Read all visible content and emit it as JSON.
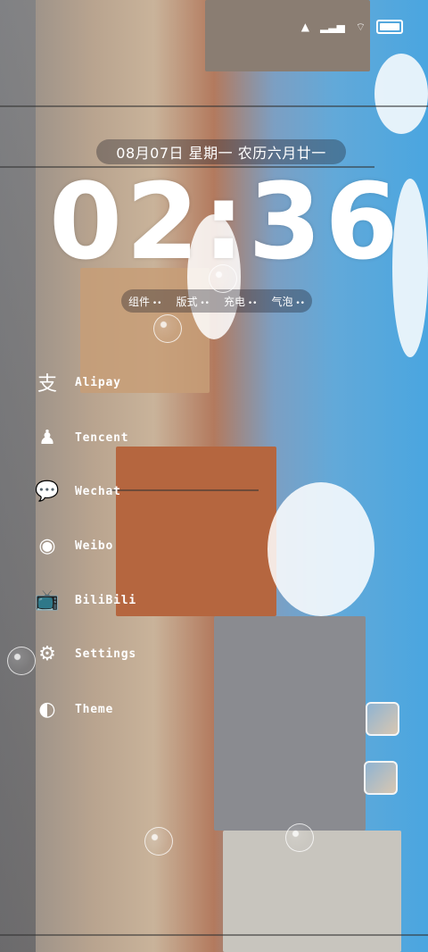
{
  "status": {
    "icons": [
      "alarm-icon",
      "signal-icon",
      "wifi-icon",
      "battery-icon"
    ]
  },
  "lock": {
    "date_text": "08月07日 星期一 农历六月廿一",
    "time": "02:36"
  },
  "tabs": [
    {
      "label": "组件"
    },
    {
      "label": "版式"
    },
    {
      "label": "充电"
    },
    {
      "label": "气泡"
    }
  ],
  "apps": [
    {
      "label": "Alipay",
      "icon": "alipay-icon",
      "glyph": "支"
    },
    {
      "label": "Tencent",
      "icon": "qq-penguin-icon",
      "glyph": "♟"
    },
    {
      "label": "Wechat",
      "icon": "wechat-icon",
      "glyph": "💬"
    },
    {
      "label": "Weibo",
      "icon": "weibo-icon",
      "glyph": "◉"
    },
    {
      "label": "BiliBili",
      "icon": "bilibili-tv-icon",
      "glyph": "📺"
    },
    {
      "label": "Settings",
      "icon": "gear-icon",
      "glyph": "⚙"
    },
    {
      "label": "Theme",
      "icon": "theme-icon",
      "glyph": "◐"
    }
  ],
  "colors": {
    "pill_bg": "#1e1e28",
    "sky": "#4aa6e0"
  }
}
